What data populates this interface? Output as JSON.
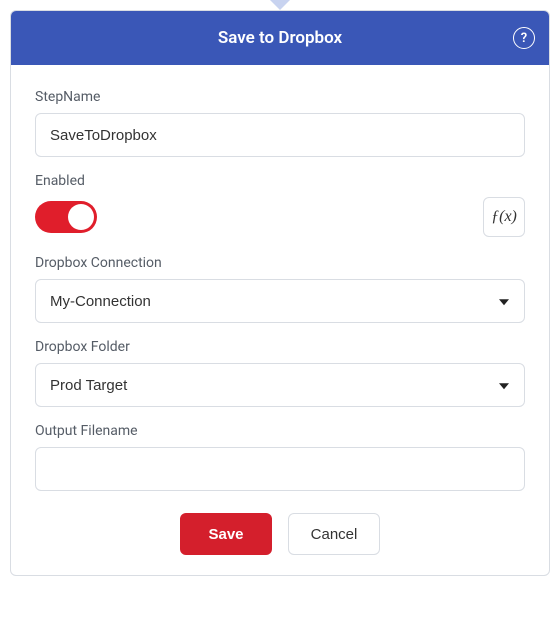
{
  "header": {
    "title": "Save to Dropbox",
    "help_icon": "?"
  },
  "fields": {
    "step_name": {
      "label": "StepName",
      "value": "SaveToDropbox"
    },
    "enabled": {
      "label": "Enabled",
      "value": true,
      "fx_label": "ƒ(x)"
    },
    "connection": {
      "label": "Dropbox Connection",
      "value": "My-Connection"
    },
    "folder": {
      "label": "Dropbox Folder",
      "value": "Prod Target"
    },
    "output_filename": {
      "label": "Output Filename",
      "value": ""
    }
  },
  "buttons": {
    "save": "Save",
    "cancel": "Cancel"
  }
}
